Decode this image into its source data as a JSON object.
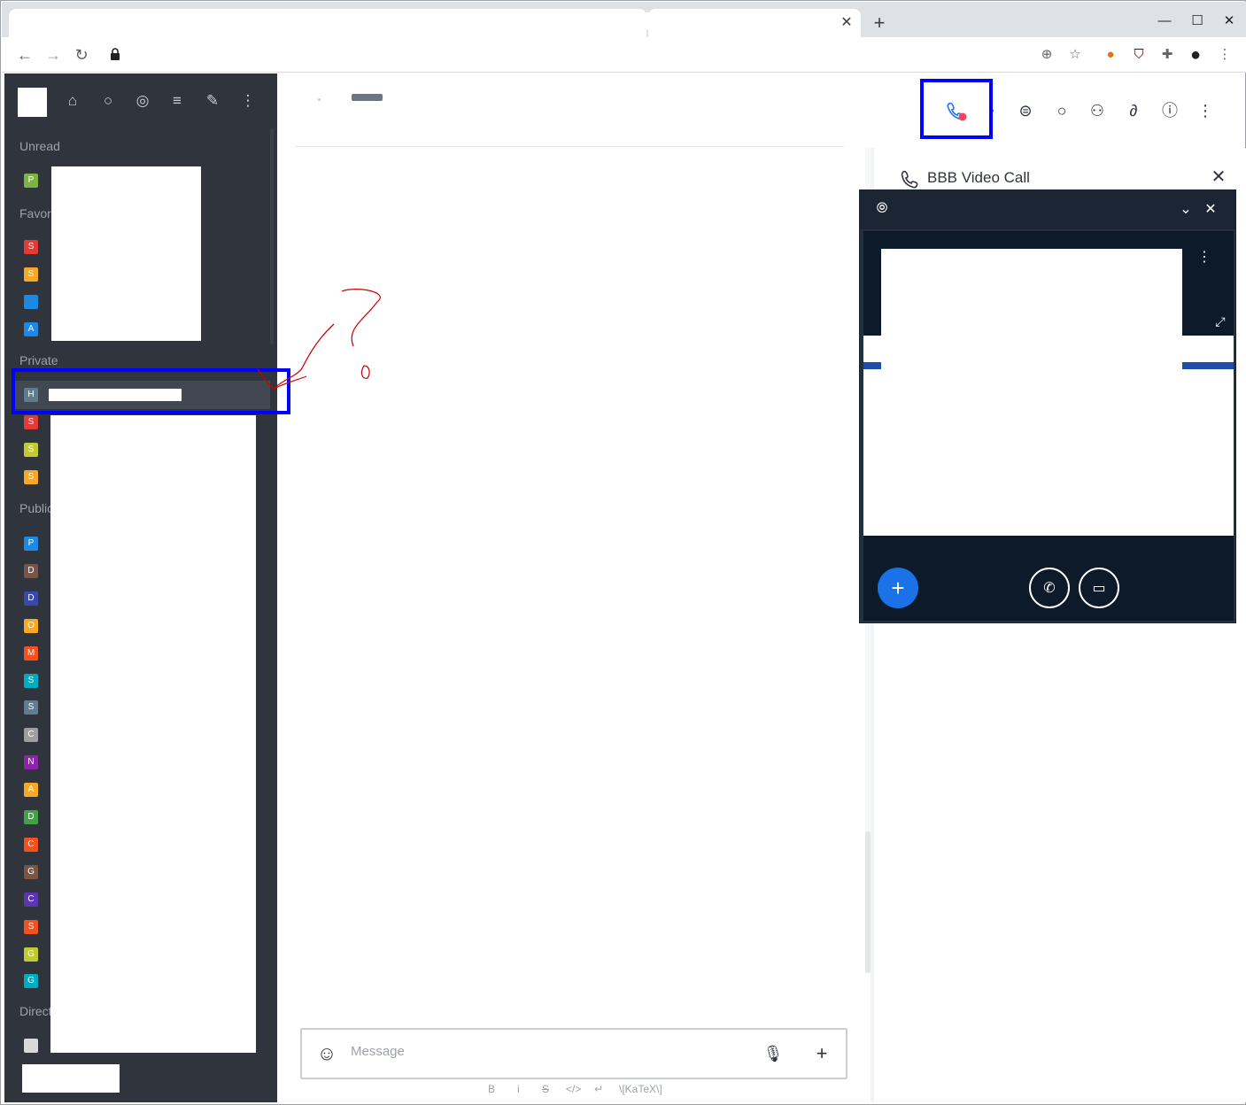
{
  "browser": {
    "new_tab_label": "+",
    "tab_close_label": "✕",
    "window_minimize": "—",
    "window_maximize": "☐",
    "window_close": "✕"
  },
  "sidebar": {
    "sections": {
      "unread": "Unread",
      "favorites": "Favori",
      "private": "Private",
      "public": "Public",
      "direct": "Direct"
    },
    "unread_rooms": [
      {
        "initial": "P",
        "color": "#7cb342"
      }
    ],
    "favorite_rooms": [
      {
        "initial": "S",
        "color": "#e53935"
      },
      {
        "initial": "S",
        "color": "#f9a825"
      },
      {
        "initial": "",
        "color": "#1e88e5"
      },
      {
        "initial": "A",
        "color": "#1e88e5"
      }
    ],
    "private_rooms": [
      {
        "initial": "H",
        "color": "#607d8b"
      },
      {
        "initial": "S",
        "color": "#e53935"
      },
      {
        "initial": "S",
        "color": "#c0ca33"
      },
      {
        "initial": "S",
        "color": "#f9a825"
      }
    ],
    "public_rooms": [
      {
        "initial": "P",
        "color": "#1e88e5"
      },
      {
        "initial": "D",
        "color": "#795548"
      },
      {
        "initial": "D",
        "color": "#3949ab"
      },
      {
        "initial": "O",
        "color": "#f9a825"
      },
      {
        "initial": "M",
        "color": "#f4511e"
      },
      {
        "initial": "S",
        "color": "#00acc1"
      },
      {
        "initial": "S",
        "color": "#607d8b"
      },
      {
        "initial": "C",
        "color": "#9e9e9e"
      },
      {
        "initial": "N",
        "color": "#8e24aa"
      },
      {
        "initial": "A",
        "color": "#f9a825"
      },
      {
        "initial": "D",
        "color": "#43a047"
      },
      {
        "initial": "C",
        "color": "#f4511e"
      },
      {
        "initial": "G",
        "color": "#795548"
      },
      {
        "initial": "C",
        "color": "#5e35b1"
      },
      {
        "initial": "S",
        "color": "#f4511e"
      },
      {
        "initial": "G",
        "color": "#c0ca33"
      },
      {
        "initial": "G",
        "color": "#00acc1"
      }
    ]
  },
  "composer": {
    "placeholder": "Message",
    "format_bold": "B",
    "format_italic": "i",
    "format_strike": "S",
    "format_code": "</>",
    "format_enter": "↵",
    "format_katex": "\\[KaTeX\\]"
  },
  "right_panel": {
    "title": "BBB Video Call"
  },
  "colors": {
    "sidebar_bg": "#2f343d",
    "highlight": "#0000ff",
    "call_active": "#1d74f5",
    "call_dot": "#f5455c",
    "bbb_join": "#1b72e8",
    "scribble": "#cc0000"
  }
}
